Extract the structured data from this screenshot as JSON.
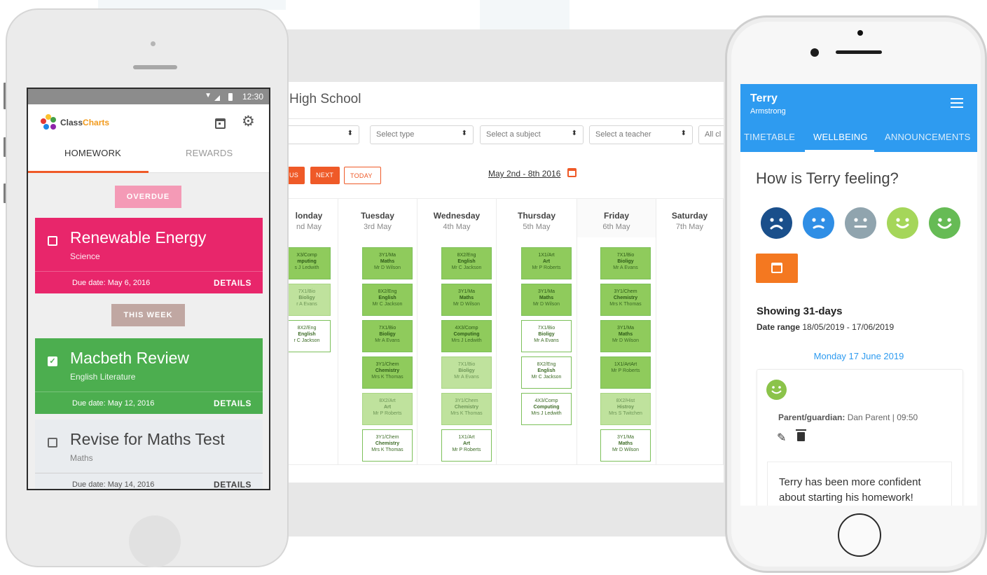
{
  "tablet": {
    "school": "High School",
    "filters": [
      {
        "label": ""
      },
      {
        "label": "Select type"
      },
      {
        "label": "Select a subject"
      },
      {
        "label": "Select a teacher"
      },
      {
        "label": "All cl"
      }
    ],
    "nav": {
      "prev": "US",
      "next": "NEXT",
      "today": "TODAY",
      "date_range": "May 2nd - 8th 2016"
    },
    "days": [
      {
        "name": "londay",
        "date": "nd May"
      },
      {
        "name": "Tuesday",
        "date": "3rd May"
      },
      {
        "name": "Wednesday",
        "date": "4th May"
      },
      {
        "name": "Thursday",
        "date": "5th May"
      },
      {
        "name": "Friday",
        "date": "6th May"
      },
      {
        "name": "Saturday",
        "date": "7th May"
      }
    ],
    "lessons": [
      [
        {
          "c": "X3/Comp",
          "s": "mputing",
          "t": "s J Ledwith",
          "style": "c-dark"
        },
        {
          "c": "7X1/Bio",
          "s": "Bioligy",
          "t": "r A Evans",
          "style": "c-light"
        },
        {
          "c": "8X2/Eng",
          "s": "English",
          "t": "r C Jackson",
          "style": "c-white"
        }
      ],
      [
        {
          "c": "3Y1/Ma",
          "s": "Maths",
          "t": "Mr D Wilson",
          "style": "c-dark"
        },
        {
          "c": "8X2/Eng",
          "s": "English",
          "t": "Mr C Jackson",
          "style": "c-dark"
        },
        {
          "c": "7X1/Bio",
          "s": "Bioligy",
          "t": "Mr A Evans",
          "style": "c-dark"
        },
        {
          "c": "3Y1/Chem",
          "s": "Chemistry",
          "t": "Mrs K Thomas",
          "style": "c-dark"
        },
        {
          "c": "8X2/Art",
          "s": "Art",
          "t": "Mr P Roberts",
          "style": "c-light"
        },
        {
          "c": "3Y1/Chem",
          "s": "Chemistry",
          "t": "Mrs K Thomas",
          "style": "c-white"
        }
      ],
      [
        {
          "c": "8X2/Eng",
          "s": "English",
          "t": "Mr C Jackson",
          "style": "c-dark"
        },
        {
          "c": "3Y1/Ma",
          "s": "Maths",
          "t": "Mr D Wilson",
          "style": "c-dark"
        },
        {
          "c": "4X3/Comp",
          "s": "Computing",
          "t": "Mrs J Ledwith",
          "style": "c-dark"
        },
        {
          "c": "7X1/Bio",
          "s": "Bioligy",
          "t": "Mr A Evans",
          "style": "c-light"
        },
        {
          "c": "3Y1/Chem",
          "s": "Chemistry",
          "t": "Mrs K Thomas",
          "style": "c-light"
        },
        {
          "c": "1X1/Art",
          "s": "Art",
          "t": "Mr P Roberts",
          "style": "c-white"
        }
      ],
      [
        {
          "c": "1X1/Art",
          "s": "Art",
          "t": "Mr P Roberts",
          "style": "c-dark"
        },
        {
          "c": "3Y1/Ma",
          "s": "Maths",
          "t": "Mr D Wilson",
          "style": "c-dark"
        },
        {
          "c": "7X1/Bio",
          "s": "Bioligy",
          "t": "Mr A Evans",
          "style": "c-white"
        },
        {
          "c": "8X2/Eng",
          "s": "English",
          "t": "Mr C Jackson",
          "style": "c-white"
        },
        {
          "c": "4X3/Comp",
          "s": "Computing",
          "t": "Mrs J Ledwith",
          "style": "c-white"
        }
      ],
      [
        {
          "c": "7X1/Bio",
          "s": "Bioligy",
          "t": "Mr A Evans",
          "style": "c-dark"
        },
        {
          "c": "3Y1/Chem",
          "s": "Chemistry",
          "t": "Mrs K Thomas",
          "style": "c-dark"
        },
        {
          "c": "3Y1/Ma",
          "s": "Maths",
          "t": "Mr D Wilson",
          "style": "c-dark"
        },
        {
          "c": "1X1/ArtArt",
          "s": "",
          "t": "Mr P Roberts",
          "style": "c-dark"
        },
        {
          "c": "8X2/Hist",
          "s": "Histroy",
          "t": "Mrs S Twitchen",
          "style": "c-light"
        },
        {
          "c": "3Y1/Ma",
          "s": "Maths",
          "t": "Mr D Wilson",
          "style": "c-white"
        }
      ]
    ]
  },
  "android": {
    "status": {
      "time": "12:30"
    },
    "logo": {
      "part1": "Class",
      "part2": "Charts"
    },
    "tabs": {
      "homework": "HOMEWORK",
      "rewards": "REWARDS"
    },
    "sections": {
      "overdue": "OVERDUE",
      "this_week": "THIS WEEK"
    },
    "cards": [
      {
        "title": "Renewable Energy",
        "subject": "Science",
        "due": "Due date: May 6, 2016",
        "details": "DETAILS",
        "checked": false
      },
      {
        "title": "Macbeth Review",
        "subject": "English Literature",
        "due": "Due date: May 12, 2016",
        "details": "DETAILS",
        "checked": true
      },
      {
        "title": "Revise for Maths Test",
        "subject": "Maths",
        "due": "Due date: May 14, 2016",
        "details": "DETAILS",
        "checked": false
      }
    ],
    "check_glyph": "✓"
  },
  "iphone": {
    "name": "Terry",
    "surname": "Armstrong",
    "tabs": {
      "timetable": "TIMETABLE",
      "wellbeing": "WELLBEING",
      "announcements": "ANNOUNCEMENTS"
    },
    "question": "How is Terry feeling?",
    "moods": [
      {
        "name": "very-sad",
        "color": "#1a4f8b"
      },
      {
        "name": "sad",
        "color": "#2f8ee5"
      },
      {
        "name": "neutral",
        "color": "#90a4ae"
      },
      {
        "name": "happy",
        "color": "#a5d65a"
      },
      {
        "name": "very-happy",
        "color": "#66bb55"
      }
    ],
    "accent": "#f47820",
    "showing": "Showing 31-days",
    "range_label": "Date range",
    "range_value": "18/05/2019 - 17/06/2019",
    "entry_date": "Monday 17 June 2019",
    "parent_label": "Parent/guardian:",
    "parent_value": "Dan Parent | 09:50",
    "note": "Terry has been more confident about starting his homework!"
  }
}
